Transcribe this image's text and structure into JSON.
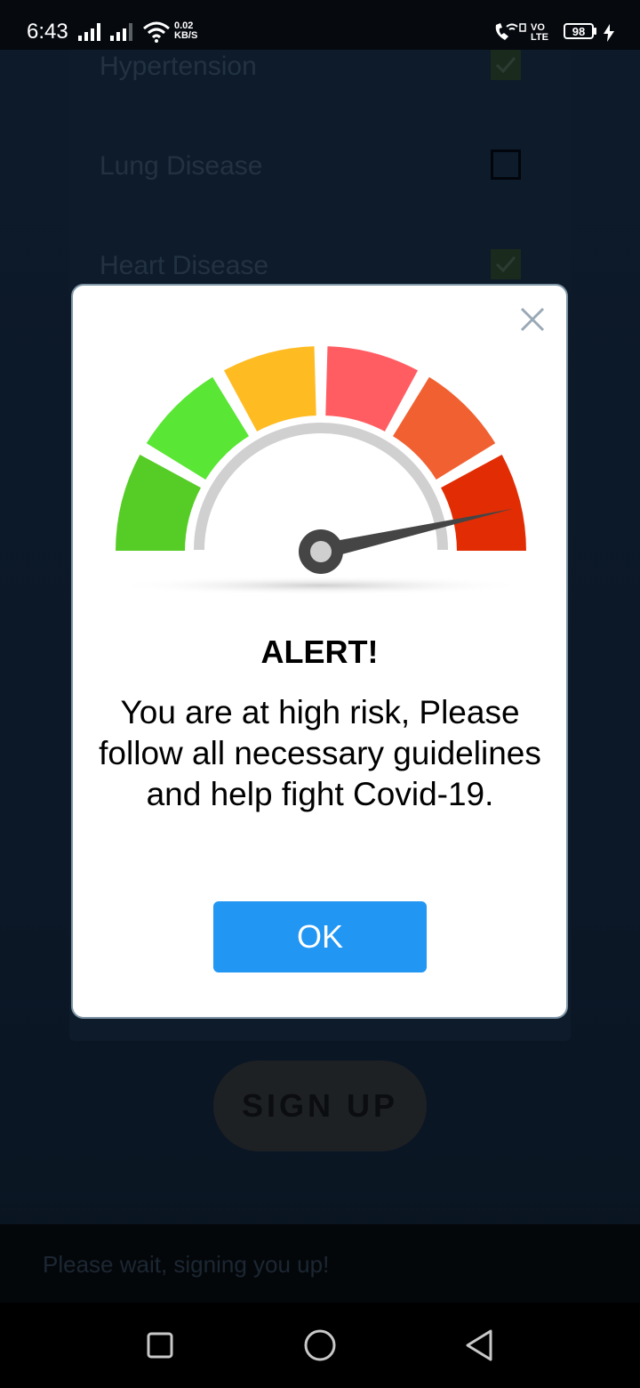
{
  "status_bar": {
    "time": "6:43",
    "net_speed_value": "0.02",
    "net_speed_unit": "KB/S",
    "volte_top": "VO",
    "volte_bottom": "LTE",
    "battery": "98"
  },
  "background": {
    "conditions": [
      {
        "label": "Hypertension",
        "checked": true
      },
      {
        "label": "Lung Disease",
        "checked": false
      },
      {
        "label": "Heart Disease",
        "checked": true
      }
    ],
    "signup_label": "SIGN UP",
    "snackbar_text": "Please wait, signing you up!"
  },
  "dialog": {
    "title": "ALERT!",
    "message": "You are at high risk, Please follow all necessary guidelines and help fight Covid-19.",
    "ok_label": "OK",
    "close_icon": "close-icon",
    "gauge": {
      "level_fraction": 0.93,
      "segment_colors": [
        "#56cc26",
        "#59e634",
        "#ffbb22",
        "#ff5d62",
        "#f16031",
        "#e22d04"
      ]
    }
  },
  "nav": {
    "icons": [
      "recents-square-icon",
      "home-circle-icon",
      "back-triangle-icon"
    ]
  },
  "colors": {
    "accent": "#2196f3",
    "dialog_border": "#7e95a5"
  }
}
